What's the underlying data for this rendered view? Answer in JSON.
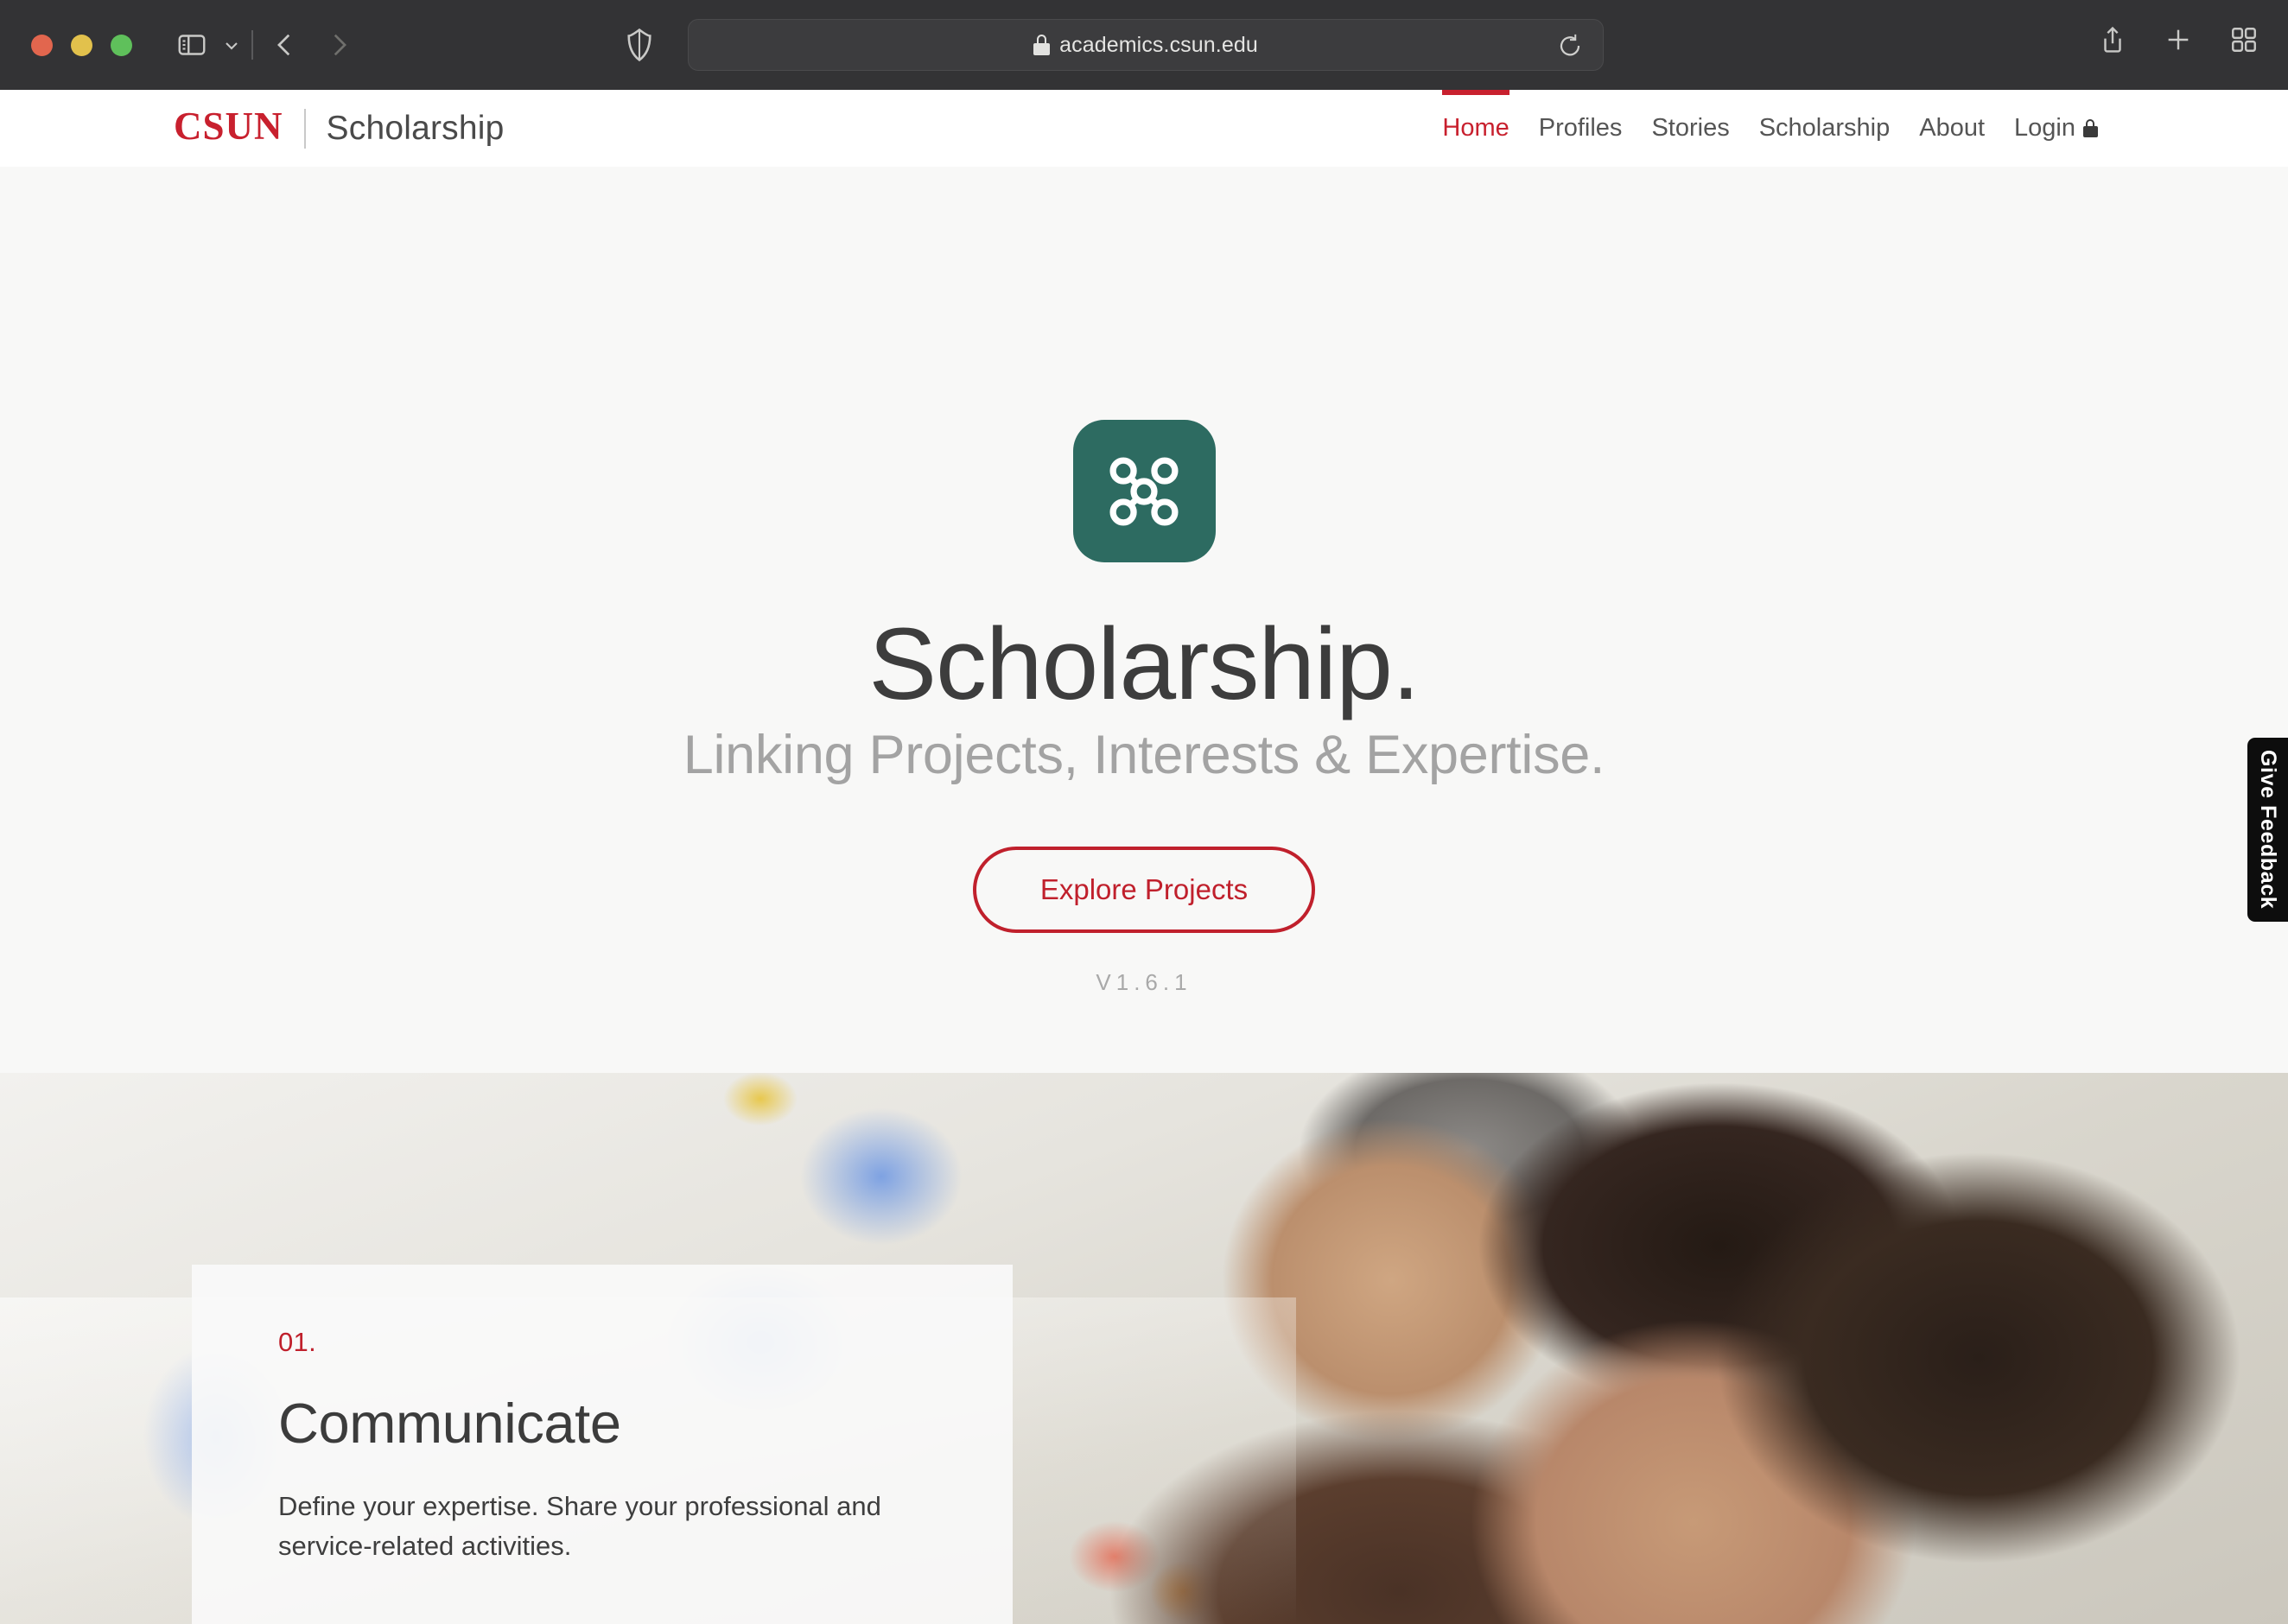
{
  "browser": {
    "url": "academics.csun.edu",
    "lock_icon": "lock-icon",
    "shield_icon": "shield-icon",
    "reload_icon": "reload-icon",
    "share_icon": "share-icon",
    "new_tab_icon": "plus-icon",
    "tab_overview_icon": "tab-grid-icon",
    "sidebar_icon": "sidebar-toggle-icon",
    "chevron_icon": "chevron-down-icon",
    "back_icon": "back-arrow-icon",
    "forward_icon": "forward-arrow-icon",
    "traffic_lights": {
      "close": "#e2664e",
      "minimize": "#e2c14c",
      "zoom": "#5fc05b"
    }
  },
  "site": {
    "brand_mark": "CSUN",
    "brand_name": "Scholarship",
    "nav": [
      {
        "label": "Home",
        "active": true,
        "has_lock": false
      },
      {
        "label": "Profiles",
        "active": false,
        "has_lock": false
      },
      {
        "label": "Stories",
        "active": false,
        "has_lock": false
      },
      {
        "label": "Scholarship",
        "active": false,
        "has_lock": false
      },
      {
        "label": "About",
        "active": false,
        "has_lock": false
      },
      {
        "label": "Login",
        "active": false,
        "has_lock": true
      }
    ]
  },
  "hero": {
    "logo_icon": "network-graph-icon",
    "logo_color": "#2d6b61",
    "title": "Scholarship.",
    "subtitle": "Linking Projects, Interests & Expertise.",
    "cta_label": "Explore Projects",
    "version": "V1.6.1",
    "accent_color": "#c0202c"
  },
  "feedback": {
    "label": "Give Feedback"
  },
  "feature_card": {
    "number": "01.",
    "title": "Communicate",
    "body": "Define your expertise. Share your professional and service-related activities."
  }
}
